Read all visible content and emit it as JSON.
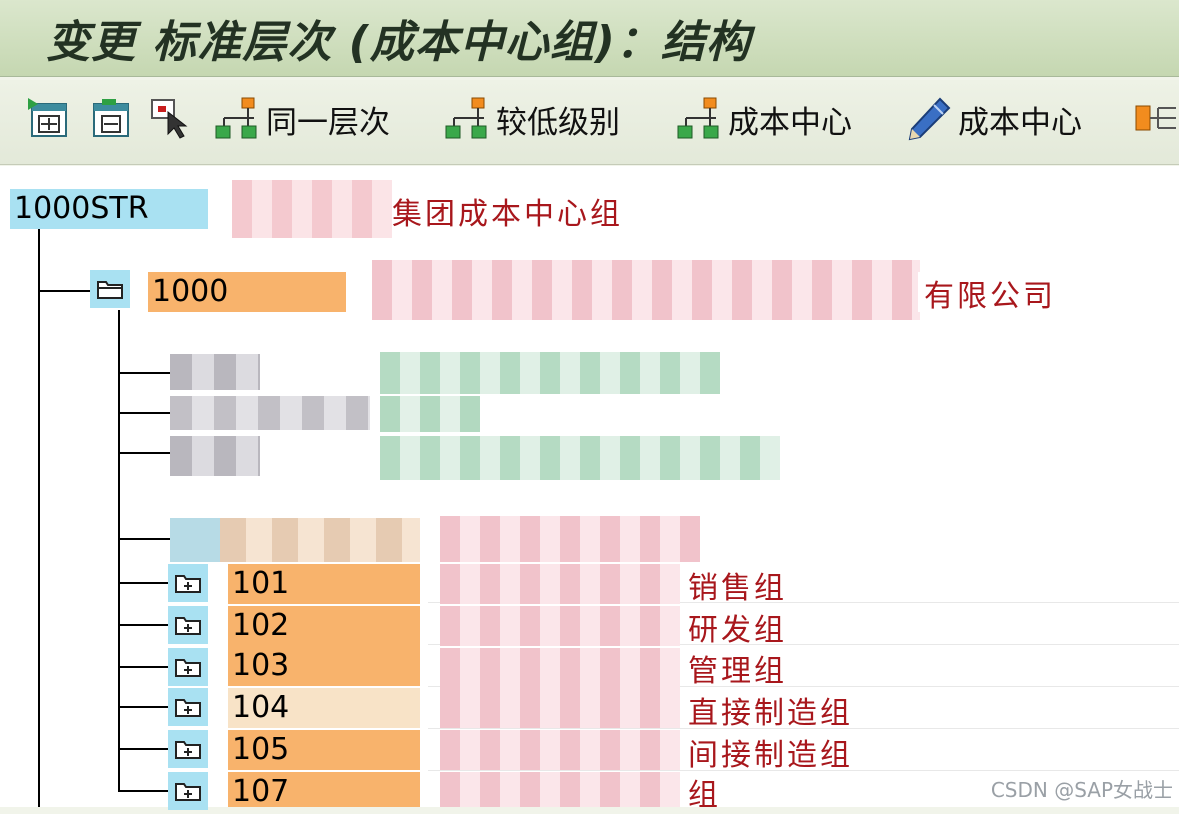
{
  "window": {
    "title": "变更 标准层次 (成本中心组)：结构"
  },
  "toolbar": {
    "expand": {
      "icon": "expand-subtree-icon"
    },
    "collapse": {
      "icon": "collapse-subtree-icon"
    },
    "select": {
      "icon": "select-pointer-icon"
    },
    "same_level": {
      "icon": "hierarchy-node-icon",
      "label": "同一层次"
    },
    "lower_level": {
      "icon": "hierarchy-node-icon",
      "label": "较低级别"
    },
    "cost_center_create": {
      "icon": "hierarchy-node-icon",
      "label": "成本中心"
    },
    "cost_center_edit": {
      "icon": "pencil-icon",
      "label": "成本中心"
    },
    "more": {
      "icon": "move-node-icon"
    }
  },
  "tree": {
    "root": {
      "code": "1000STR",
      "description": "集团成本中心组"
    },
    "company": {
      "code": "1000",
      "description": "有限公司"
    },
    "groups": [
      {
        "code": "101",
        "description": "销售组"
      },
      {
        "code": "102",
        "description": "研发组"
      },
      {
        "code": "103",
        "description": "管理组"
      },
      {
        "code": "104",
        "description": "直接制造组"
      },
      {
        "code": "105",
        "description": "间接制造组"
      },
      {
        "code": "107",
        "description": "组"
      }
    ]
  },
  "colors": {
    "title_bar": "#c5d7b1",
    "selected_node": "#a9e1f2",
    "group_node": "#f8b36c",
    "highlight_node": "#f8e3c7",
    "description_text": "#a8171c"
  },
  "watermark": "CSDN @SAP女战士"
}
